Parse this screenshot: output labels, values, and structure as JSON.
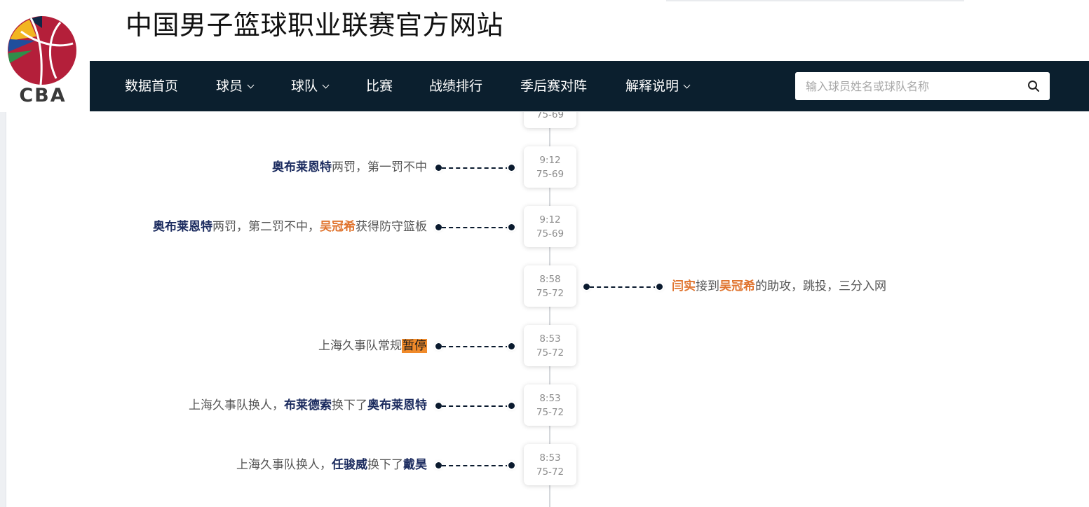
{
  "header": {
    "site_title": "中国男子篮球职业联赛官方网站",
    "logo_text": "CBA"
  },
  "nav": {
    "items": [
      {
        "label": "数据首页",
        "has_dropdown": false
      },
      {
        "label": "球员",
        "has_dropdown": true
      },
      {
        "label": "球队",
        "has_dropdown": true
      },
      {
        "label": "比赛",
        "has_dropdown": false
      },
      {
        "label": "战绩排行",
        "has_dropdown": false
      },
      {
        "label": "季后赛对阵",
        "has_dropdown": false
      },
      {
        "label": "解释说明",
        "has_dropdown": true
      }
    ],
    "search_placeholder": "输入球员姓名或球队名称"
  },
  "events": [
    {
      "time": "9:12",
      "score": "75-69",
      "side": "left",
      "parts": [
        {
          "t": "奥布莱恩特",
          "s": "p"
        },
        {
          "t": "两罚，第一罚不中"
        }
      ]
    },
    {
      "time": "9:12",
      "score": "75-69",
      "side": "left",
      "parts": [
        {
          "t": "奥布莱恩特",
          "s": "p"
        },
        {
          "t": "两罚，第二罚不中，"
        },
        {
          "t": "吴冠希",
          "s": "o"
        },
        {
          "t": "获得防守篮板"
        }
      ]
    },
    {
      "time": "8:58",
      "score": "75-72",
      "side": "right",
      "parts": [
        {
          "t": "闫实",
          "s": "o"
        },
        {
          "t": "接到"
        },
        {
          "t": "吴冠希",
          "s": "o"
        },
        {
          "t": "的助攻，跳投，三分入网"
        }
      ]
    },
    {
      "time": "8:53",
      "score": "75-72",
      "side": "left",
      "parts": [
        {
          "t": "上海久事队常规"
        },
        {
          "t": "暂停",
          "s": "h"
        }
      ]
    },
    {
      "time": "8:53",
      "score": "75-72",
      "side": "left",
      "parts": [
        {
          "t": "上海久事队换人，"
        },
        {
          "t": "布莱德索",
          "s": "p"
        },
        {
          "t": "换下了"
        },
        {
          "t": "奥布莱恩特",
          "s": "p"
        }
      ]
    },
    {
      "time": "8:53",
      "score": "75-72",
      "side": "left",
      "parts": [
        {
          "t": "上海久事队换人，"
        },
        {
          "t": "任骏威",
          "s": "p"
        },
        {
          "t": "换下了"
        },
        {
          "t": "戴昊",
          "s": "p"
        }
      ]
    }
  ],
  "partial_events": {
    "top": {
      "score": "75-69"
    }
  },
  "colors": {
    "nav_bg": "#0b1f2e",
    "player_home": "#1a2a5e",
    "player_away": "#e0742f",
    "highlight": "#f08a2a"
  }
}
